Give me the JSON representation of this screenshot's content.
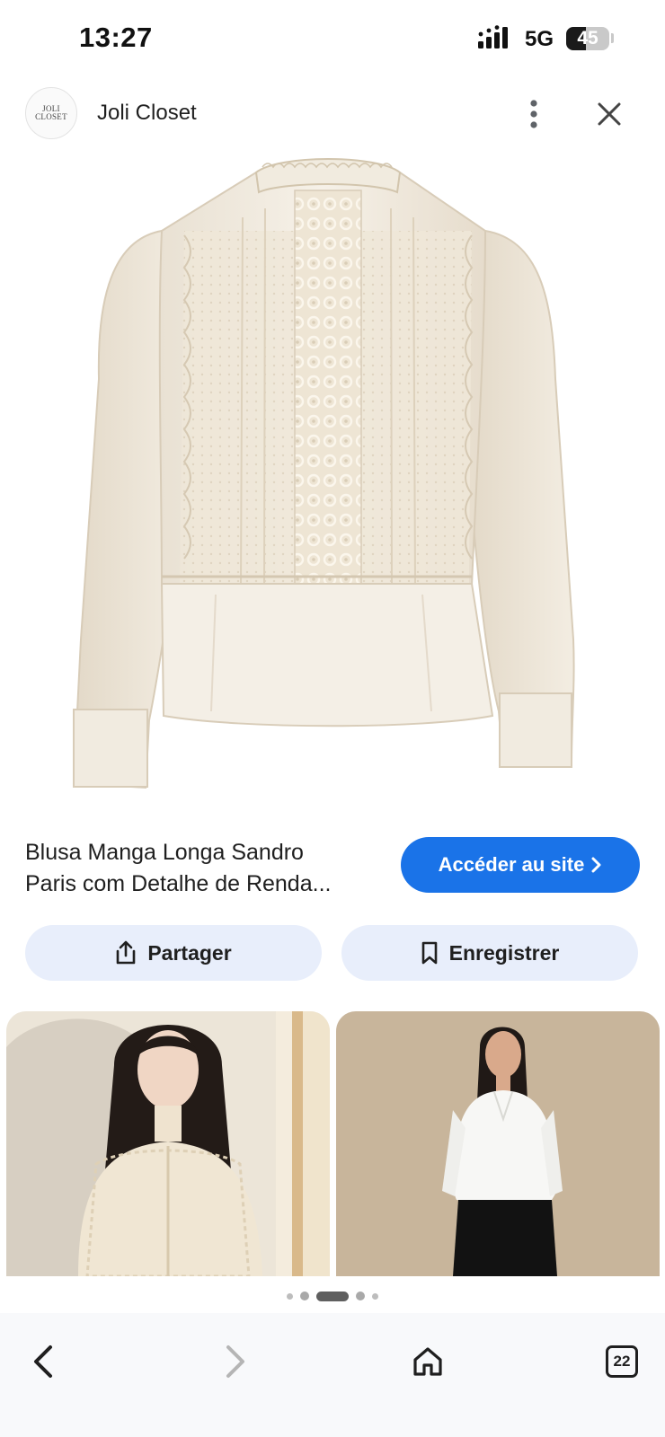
{
  "status_bar": {
    "time": "13:27",
    "network": "5G",
    "battery": "45",
    "battery_level": 0.45
  },
  "header": {
    "logo_line1": "JOLI",
    "logo_line2": "CLOSET",
    "site_name": "Joli Closet",
    "icons": {
      "more": "more-vert-icon",
      "close": "close-icon"
    }
  },
  "product": {
    "title_line1": "Blusa Manga Longa Sandro",
    "title_line2": "Paris com Detalhe de Renda...",
    "visit_label": "Accéder au site",
    "share_label": "Partager",
    "save_label": "Enregistrer"
  },
  "carousel": {
    "page_count": 5,
    "active_index": 2
  },
  "bottom_nav": {
    "tabs_count": "22",
    "icons": {
      "back": "back-arrow-icon",
      "forward": "forward-arrow-icon",
      "home": "home-icon",
      "tabs": "tabs-icon"
    }
  },
  "colors": {
    "accent": "#1a73e8",
    "pill_bg": "#e8eefb",
    "blouse": "#f3ede3"
  }
}
